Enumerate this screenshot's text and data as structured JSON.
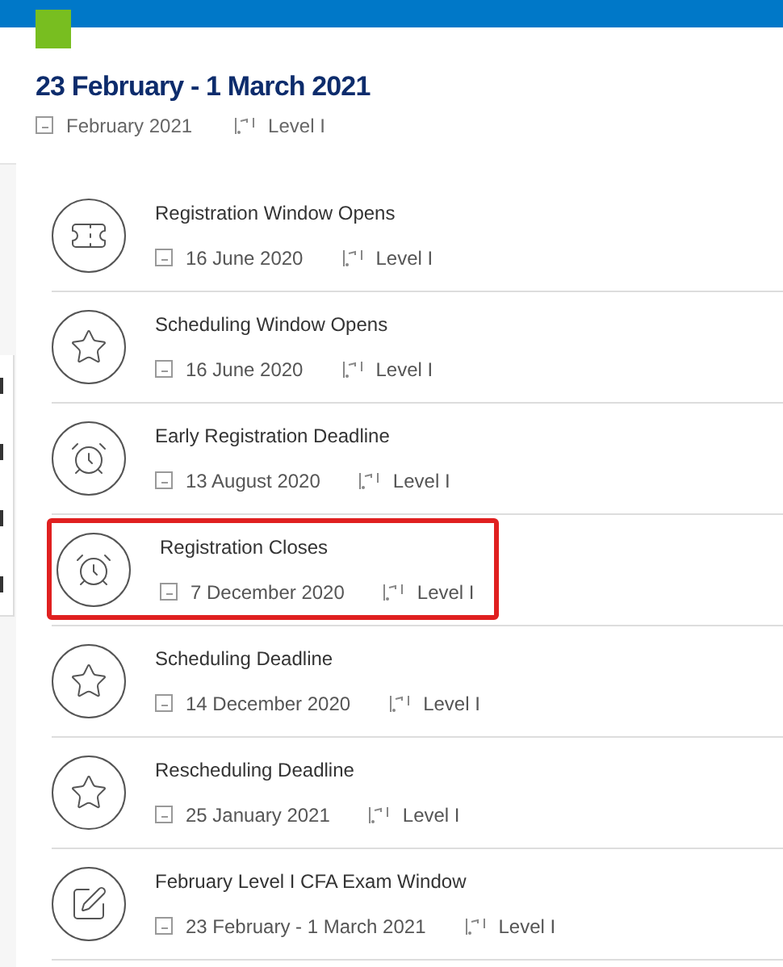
{
  "header": {
    "title": "23 February - 1 March 2021",
    "month": "February 2021",
    "level": "Level I"
  },
  "events": [
    {
      "kind": "registration",
      "title": "Registration Window Opens",
      "date": "16 June 2020",
      "level": "Level I",
      "highlighted": false
    },
    {
      "kind": "scheduling",
      "title": "Scheduling Window Opens",
      "date": "16 June 2020",
      "level": "Level I",
      "highlighted": false
    },
    {
      "kind": "deadline",
      "title": "Early Registration Deadline",
      "date": "13 August 2020",
      "level": "Level I",
      "highlighted": false
    },
    {
      "kind": "deadline",
      "title": "Registration Closes",
      "date": "7 December 2020",
      "level": "Level I",
      "highlighted": true
    },
    {
      "kind": "scheduling",
      "title": "Scheduling Deadline",
      "date": "14 December 2020",
      "level": "Level I",
      "highlighted": false
    },
    {
      "kind": "scheduling",
      "title": "Rescheduling Deadline",
      "date": "25 January 2021",
      "level": "Level I",
      "highlighted": false
    },
    {
      "kind": "exam",
      "title": "February Level I CFA Exam Window",
      "date": "23 February - 1 March 2021",
      "level": "Level I",
      "highlighted": false
    }
  ]
}
